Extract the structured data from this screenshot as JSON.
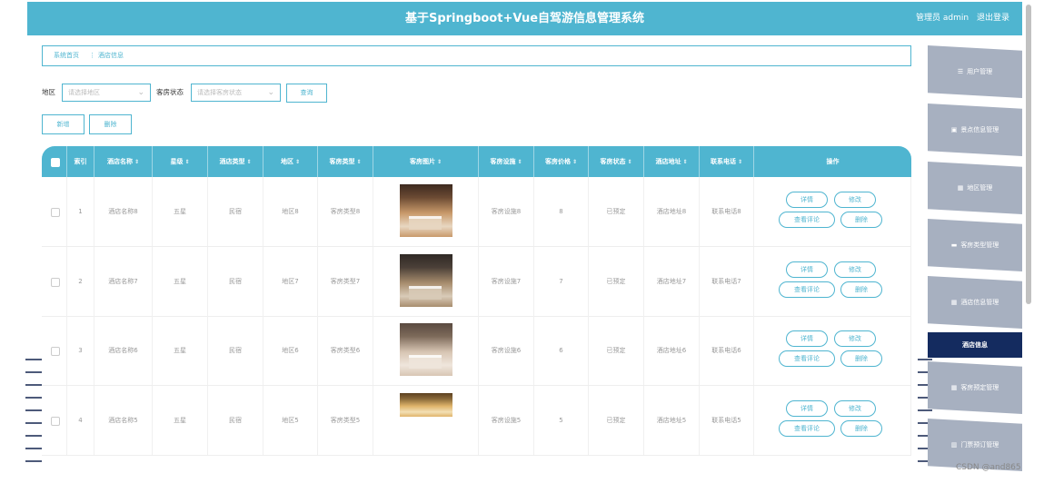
{
  "header": {
    "title": "基于Springboot+Vue自驾游信息管理系统",
    "user_label": "管理员 admin",
    "logout_label": "退出登录"
  },
  "breadcrumb": {
    "home": "系统首页",
    "separator": "⋮",
    "current": "酒店信息"
  },
  "filters": {
    "region_label": "地区",
    "region_placeholder": "请选择地区",
    "room_status_label": "客房状态",
    "room_status_placeholder": "请选择客房状态",
    "query_button": "查询",
    "add_button": "新增",
    "delete_button": "删除"
  },
  "table": {
    "columns": [
      "索引",
      "酒店名称",
      "星级",
      "酒店类型",
      "地区",
      "客房类型",
      "客房图片",
      "客房设施",
      "客房价格",
      "客房状态",
      "酒店地址",
      "联系电话",
      "操作"
    ],
    "sort_icon": "⇕",
    "actions": {
      "detail": "详情",
      "edit": "修改",
      "review": "查看评论",
      "delete": "删除"
    },
    "rows": [
      {
        "index": "1",
        "name": "酒店名称8",
        "star": "五星",
        "type": "民宿",
        "region": "地区8",
        "room_type": "客房类型8",
        "facility": "客房设施8",
        "price": "8",
        "status": "已预定",
        "address": "酒店地址8",
        "phone": "联系电话8",
        "image": "room-photo-1"
      },
      {
        "index": "2",
        "name": "酒店名称7",
        "star": "五星",
        "type": "民宿",
        "region": "地区7",
        "room_type": "客房类型7",
        "facility": "客房设施7",
        "price": "7",
        "status": "已预定",
        "address": "酒店地址7",
        "phone": "联系电话7",
        "image": "room-photo-2"
      },
      {
        "index": "3",
        "name": "酒店名称6",
        "star": "五星",
        "type": "民宿",
        "region": "地区6",
        "room_type": "客房类型6",
        "facility": "客房设施6",
        "price": "6",
        "status": "已预定",
        "address": "酒店地址6",
        "phone": "联系电话6",
        "image": "room-photo-3"
      },
      {
        "index": "4",
        "name": "酒店名称5",
        "star": "五星",
        "type": "民宿",
        "region": "地区5",
        "room_type": "客房类型5",
        "facility": "客房设施5",
        "price": "5",
        "status": "已预定",
        "address": "酒店地址5",
        "phone": "联系电话5",
        "image": "room-photo-4"
      }
    ]
  },
  "sidebar": {
    "items": [
      {
        "label": "用户管理",
        "icon": "☰"
      },
      {
        "label": "景点信息管理",
        "icon": "▣"
      },
      {
        "label": "地区管理",
        "icon": "▦"
      },
      {
        "label": "客房类型管理",
        "icon": "▬"
      },
      {
        "label": "酒店信息管理",
        "icon": "▦"
      },
      {
        "label": "客房预定管理",
        "icon": "▦"
      },
      {
        "label": "门票预订管理",
        "icon": "▥"
      }
    ],
    "active_label": "酒店信息"
  },
  "watermark": "CSDN @and865",
  "colors": {
    "accent": "#4fb5d0",
    "sidebar_active": "#142b5f",
    "sidebar_item": "#a7b0c0"
  }
}
